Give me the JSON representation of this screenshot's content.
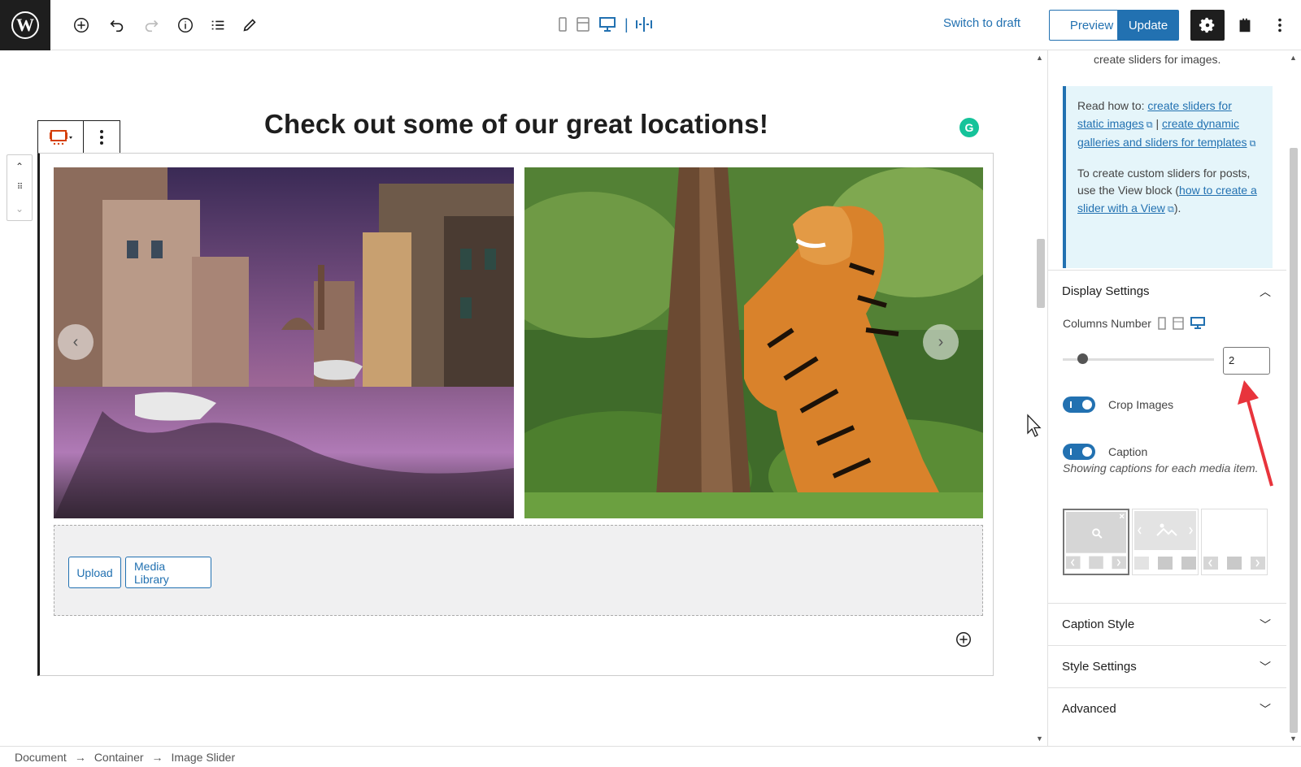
{
  "toolbar": {
    "switch_to_draft": "Switch to draft",
    "preview": "Preview",
    "update": "Update",
    "icons": [
      "wordpress-logo",
      "add-block-icon",
      "undo-icon",
      "redo-icon",
      "info-icon",
      "list-view-icon",
      "edit-icon",
      "mobile-preview-icon",
      "tablet-preview-icon",
      "desktop-preview-icon",
      "spacing-icon",
      "settings-gear-icon",
      "plugin-icon",
      "more-options-icon"
    ]
  },
  "editor": {
    "heading": "Check out some of our great locations!",
    "upload_label": "Upload",
    "media_library_label": "Media Library",
    "images": [
      {
        "name": "venice-canal",
        "alt": ""
      },
      {
        "name": "tiger-tree",
        "alt": ""
      }
    ]
  },
  "sidebar": {
    "top_text": "create sliders for images.",
    "notice": {
      "prefix": "Read how to: ",
      "link1": "create sliders for static images",
      "separator": " | ",
      "link2": "create dynamic galleries and sliders for templates",
      "para2_prefix": "To create custom sliders for posts, use the View block (",
      "link3": "how to create a slider with a View",
      "para2_suffix": ")."
    },
    "display_settings": {
      "title": "Display Settings",
      "columns_label": "Columns Number",
      "columns_value": "2",
      "columns_fraction": 0.1,
      "crop_images_label": "Crop Images",
      "crop_images_on": true,
      "caption_label": "Caption",
      "caption_on": true,
      "caption_help": "Showing captions for each media item."
    },
    "panels": [
      "Caption Style",
      "Style Settings",
      "Advanced"
    ]
  },
  "breadcrumb": [
    "Document",
    "Container",
    "Image Slider"
  ],
  "colors": {
    "accent": "#2271b1",
    "dark": "#1e1e1e",
    "notice_bg": "#e5f5fa",
    "annotation": "#e8343c"
  }
}
